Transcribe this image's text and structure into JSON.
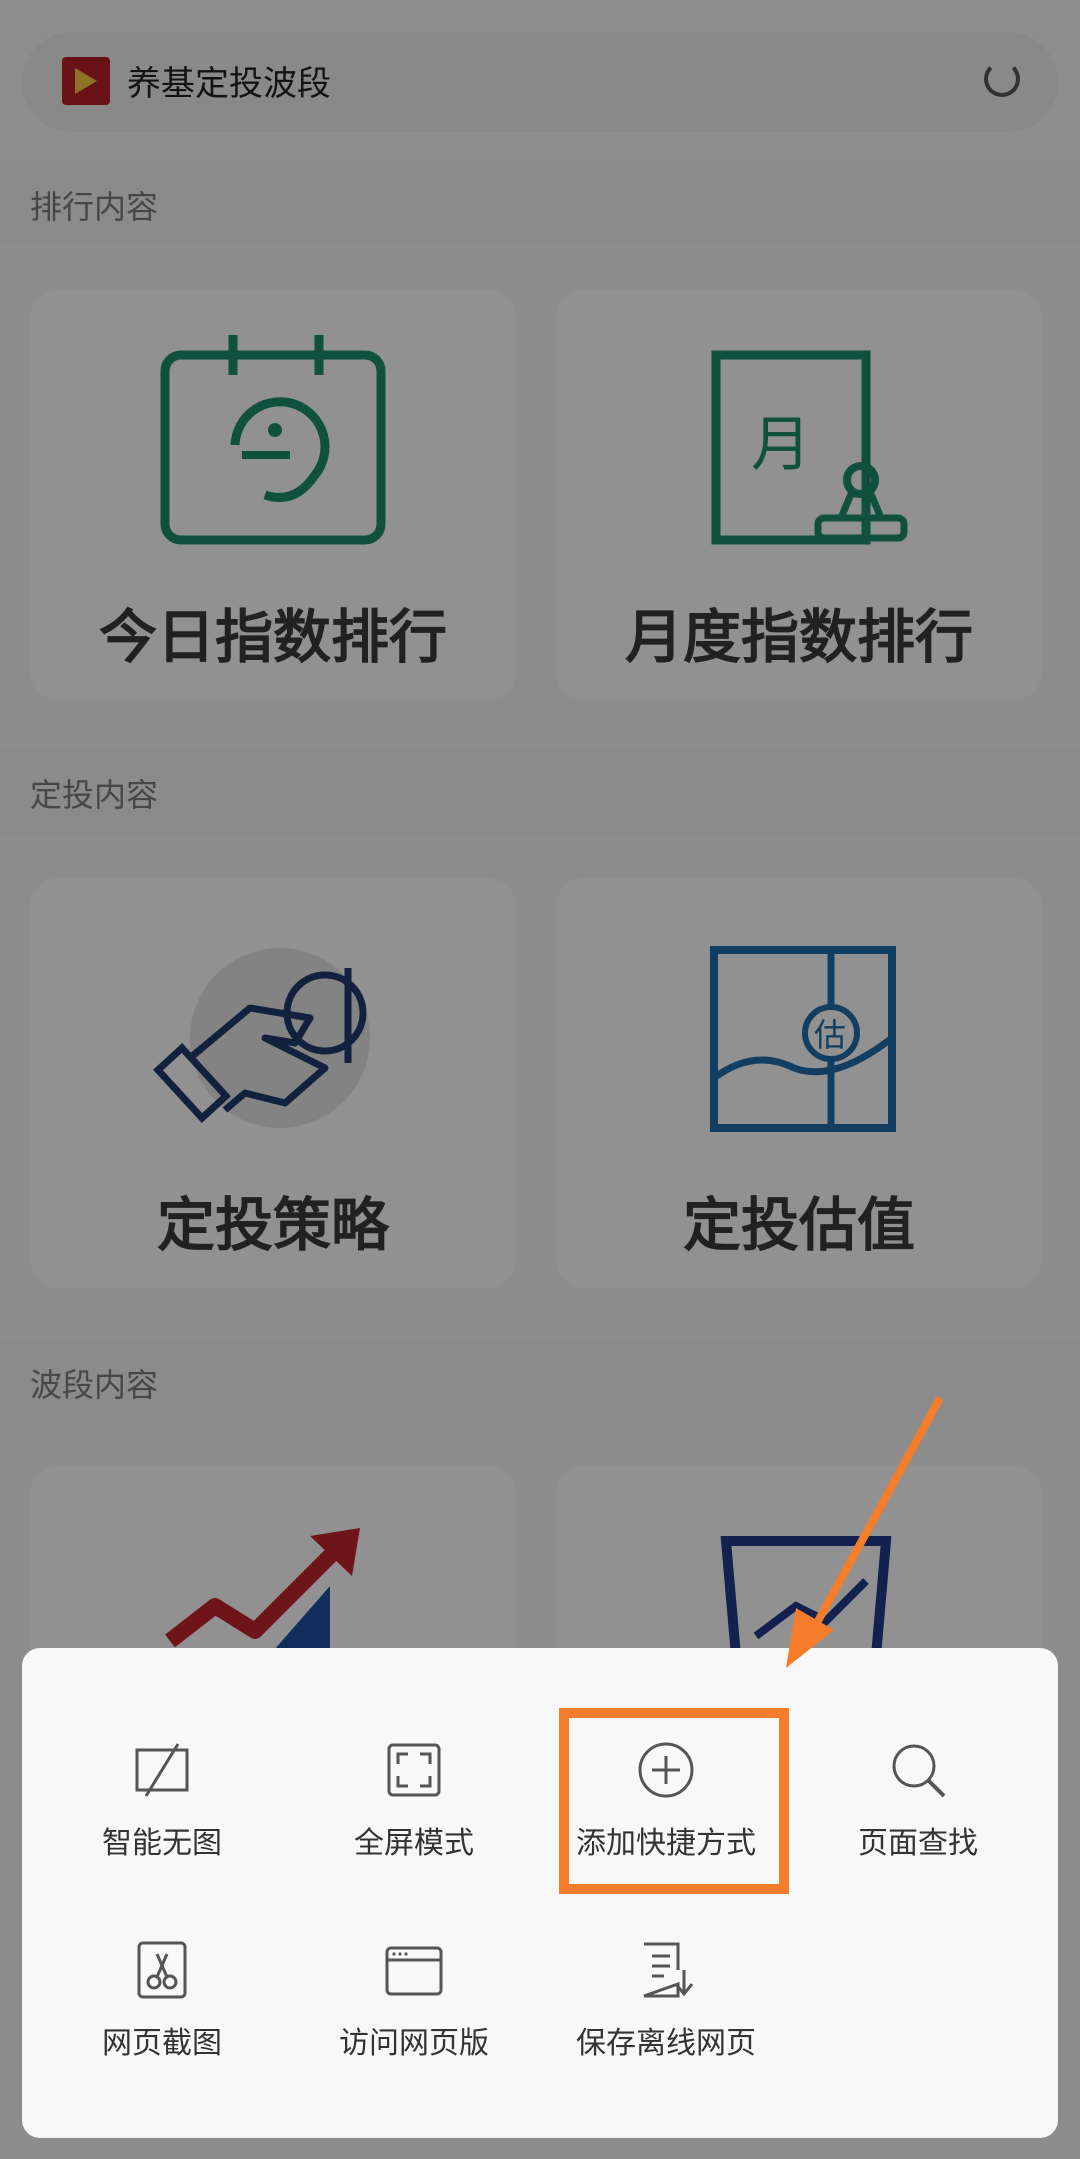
{
  "topbar": {
    "title": "养基定投波段",
    "app_icon": "app-logo-icon",
    "refresh_icon": "refresh-icon"
  },
  "sections": [
    {
      "label": "排行内容",
      "cards": [
        {
          "title": "今日指数排行",
          "icon": "calendar-today-icon"
        },
        {
          "title": "月度指数排行",
          "icon": "monthly-document-stamp-icon"
        }
      ]
    },
    {
      "label": "定投内容",
      "cards": [
        {
          "title": "定投策略",
          "icon": "hand-coin-icon"
        },
        {
          "title": "定投估值",
          "icon": "valuation-map-icon"
        }
      ]
    },
    {
      "label": "波段内容",
      "cards": [
        {
          "title": "",
          "icon": "trend-arrow-icon"
        },
        {
          "title": "",
          "icon": "shield-chart-icon"
        }
      ]
    }
  ],
  "sheet": {
    "row1": [
      {
        "label": "智能无图",
        "icon": "no-image-icon"
      },
      {
        "label": "全屏模式",
        "icon": "fullscreen-icon"
      },
      {
        "label": "添加快捷方式",
        "icon": "add-circle-icon"
      },
      {
        "label": "页面查找",
        "icon": "search-icon"
      }
    ],
    "row2": [
      {
        "label": "网页截图",
        "icon": "scissors-icon"
      },
      {
        "label": "访问网页版",
        "icon": "browser-window-icon"
      },
      {
        "label": "保存离线网页",
        "icon": "save-document-icon"
      }
    ]
  },
  "colors": {
    "highlight": "#f47c2b",
    "green": "#1a8c6a",
    "navy": "#1f3a6b",
    "blue": "#1e6ba8",
    "red": "#c0232b"
  }
}
